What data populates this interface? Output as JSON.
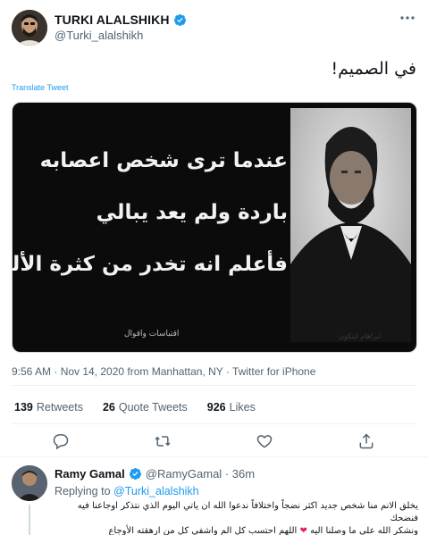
{
  "author": {
    "name": "TURKI ALALSHIKH",
    "handle": "@Turki_alalshikh"
  },
  "tweet": {
    "text": "في الصميم!",
    "translate_label": "Translate Tweet",
    "meta": "9:56 AM · Nov 14, 2020 from Manhattan, NY · Twitter for iPhone"
  },
  "media": {
    "lines": [
      "عندما ترى شخص اعصابه",
      "باردة ولم يعد يبالي",
      "فأعلم انه تخدر من كثرة الألم"
    ],
    "caption_left": "اقتباسات واقوال",
    "caption_right": "ابراهام لينكون"
  },
  "stats": {
    "retweets_count": "139",
    "retweets_label": "Retweets",
    "quotes_count": "26",
    "quotes_label": "Quote Tweets",
    "likes_count": "926",
    "likes_label": "Likes"
  },
  "reply": {
    "name": "Ramy Gamal",
    "handle": "@RamyGamal · 36m",
    "replying_prefix": "Replying to",
    "replying_to": "@Turki_alalshikh",
    "text_line1": "يخلق الانم منا شخص جديد اكثر نضجاً واختلافاً ندعوا الله ان ياتي اليوم الذي نتذكر اوجاعنا فيه فنضحك",
    "text_line2_a": "ونشكر الله علي ما وصلنا اليه",
    "text_line2_b": "اللهم احتسب كل الم واشفي كل من ارهقته الأوجاع"
  },
  "colors": {
    "accent": "#1d9bf0",
    "verified": "#1d9bf0",
    "muted": "#536471",
    "heart": "#e0245e"
  },
  "icons": [
    "more-icon",
    "verified-icon",
    "reply-icon",
    "retweet-icon",
    "like-icon",
    "share-icon"
  ]
}
